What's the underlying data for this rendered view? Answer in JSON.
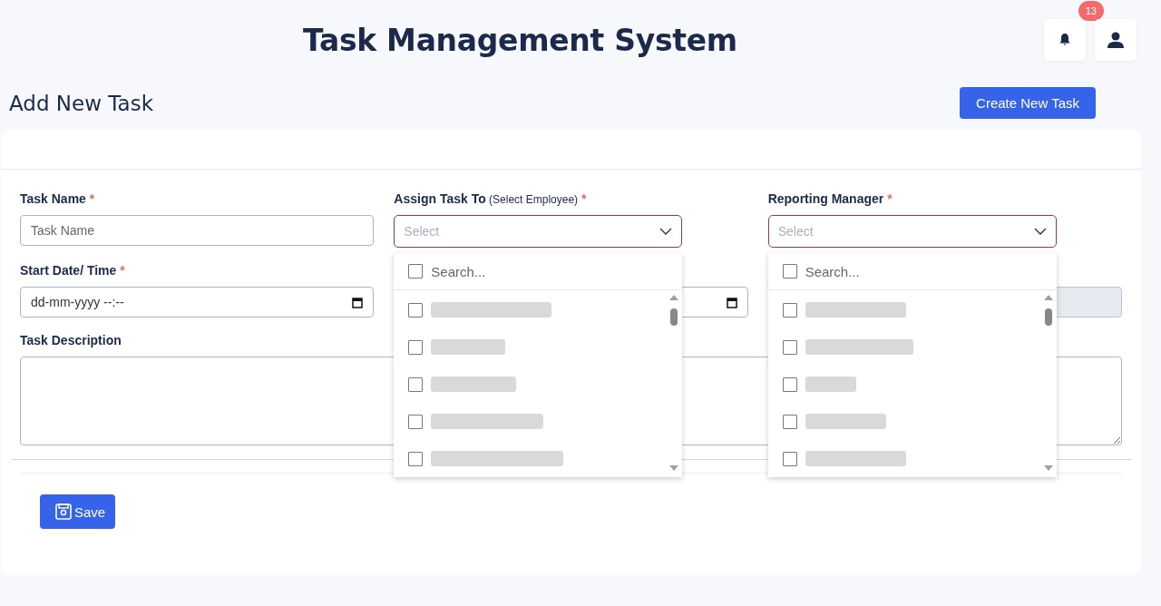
{
  "header": {
    "title": "Task Management System",
    "notifications": {
      "count": "13"
    }
  },
  "page": {
    "title": "Add New Task",
    "create_button": "Create New Task"
  },
  "form": {
    "fields": [
      {
        "kind": "text",
        "label": "Task Name",
        "required_mark": "*",
        "placeholder": "Task Name"
      },
      {
        "kind": "multiselect",
        "label": "Assign Task To",
        "hint": "(Select Employee)",
        "required_mark": "*",
        "placeholder": "Select",
        "expanded": true,
        "search_placeholder": "Search...",
        "select_all_checked": false,
        "options": [
          {
            "checked": false
          },
          {
            "checked": false
          },
          {
            "checked": false
          },
          {
            "checked": false
          },
          {
            "checked": false
          }
        ]
      },
      {
        "kind": "multiselect",
        "label": "Reporting Manager",
        "required_mark": "*",
        "placeholder": "Select",
        "expanded": true,
        "search_placeholder": "Search...",
        "select_all_checked": false,
        "options": [
          {
            "checked": false
          },
          {
            "checked": false
          },
          {
            "checked": false
          },
          {
            "checked": false
          },
          {
            "checked": false
          }
        ]
      },
      {
        "kind": "datetime",
        "label": "Start Date/ Time",
        "required_mark": "*",
        "value": "dd-mm-yyyy --:--"
      },
      {
        "kind": "datetime"
      },
      {
        "kind": "text",
        "disabled": true
      },
      {
        "kind": "textarea",
        "label": "Task Description"
      }
    ]
  },
  "save_button": "Save"
}
